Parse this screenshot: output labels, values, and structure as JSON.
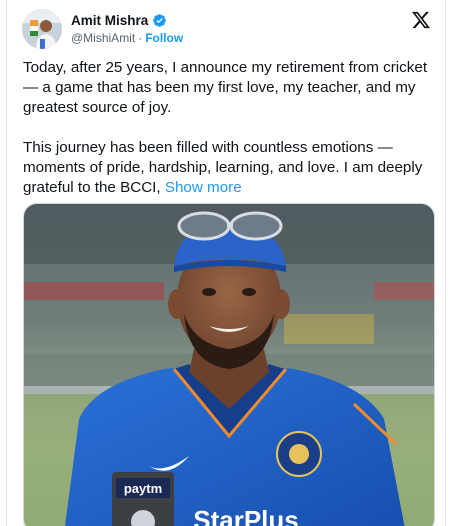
{
  "tweet": {
    "author": {
      "name": "Amit Mishra",
      "handle": "@MishiAmit",
      "separator": "·",
      "follow_label": "Follow",
      "verified": true
    },
    "paragraphs": [
      "Today, after 25 years, I announce my retirement from cricket — a game that has been my first love, my teacher, and my greatest source of joy.",
      "This journey has been filled with countless emotions — moments of pride, hardship, learning, and love. I am deeply grateful to the BCCI, "
    ],
    "show_more_label": "Show more",
    "media": {
      "sponsor_left": "paytm",
      "sponsor_chest": "StarPlus"
    }
  },
  "colors": {
    "link": "#1d9bf0",
    "text": "#0f1419",
    "muted": "#536471",
    "jersey": "#1f5fc4"
  },
  "icons": {
    "verified": "verified-badge-icon",
    "x_logo": "x-logo-icon"
  }
}
